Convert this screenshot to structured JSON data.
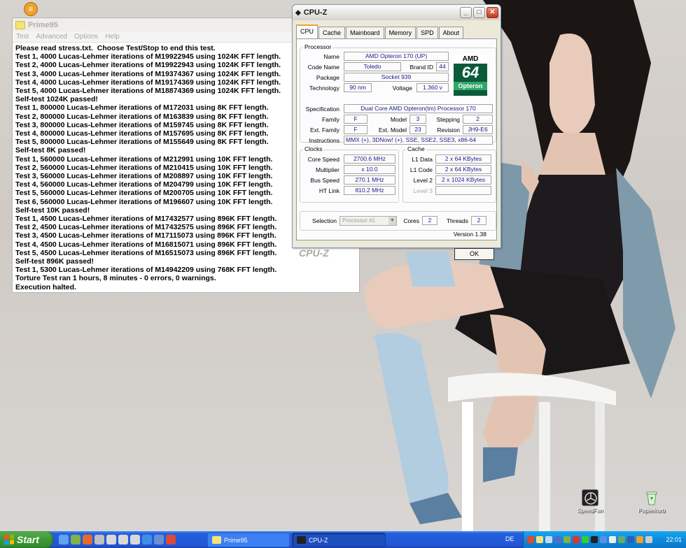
{
  "prime95": {
    "title": "Prime95",
    "menu": [
      "Test",
      "Advanced",
      "Options",
      "Help"
    ],
    "log": [
      "Please read stress.txt.  Choose Test/Stop to end this test.",
      "Test 1, 4000 Lucas-Lehmer iterations of M19922945 using 1024K FFT length.",
      "Test 2, 4000 Lucas-Lehmer iterations of M19922943 using 1024K FFT length.",
      "Test 3, 4000 Lucas-Lehmer iterations of M19374367 using 1024K FFT length.",
      "Test 4, 4000 Lucas-Lehmer iterations of M19174369 using 1024K FFT length.",
      "Test 5, 4000 Lucas-Lehmer iterations of M18874369 using 1024K FFT length.",
      "Self-test 1024K passed!",
      "Test 1, 800000 Lucas-Lehmer iterations of M172031 using 8K FFT length.",
      "Test 2, 800000 Lucas-Lehmer iterations of M163839 using 8K FFT length.",
      "Test 3, 800000 Lucas-Lehmer iterations of M159745 using 8K FFT length.",
      "Test 4, 800000 Lucas-Lehmer iterations of M157695 using 8K FFT length.",
      "Test 5, 800000 Lucas-Lehmer iterations of M155649 using 8K FFT length.",
      "Self-test 8K passed!",
      "Test 1, 560000 Lucas-Lehmer iterations of M212991 using 10K FFT length.",
      "Test 2, 560000 Lucas-Lehmer iterations of M210415 using 10K FFT length.",
      "Test 3, 560000 Lucas-Lehmer iterations of M208897 using 10K FFT length.",
      "Test 4, 560000 Lucas-Lehmer iterations of M204799 using 10K FFT length.",
      "Test 5, 560000 Lucas-Lehmer iterations of M200705 using 10K FFT length.",
      "Test 6, 560000 Lucas-Lehmer iterations of M196607 using 10K FFT length.",
      "Self-test 10K passed!",
      "Test 1, 4500 Lucas-Lehmer iterations of M17432577 using 896K FFT length.",
      "Test 2, 4500 Lucas-Lehmer iterations of M17432575 using 896K FFT length.",
      "Test 3, 4500 Lucas-Lehmer iterations of M17115073 using 896K FFT length.",
      "Test 4, 4500 Lucas-Lehmer iterations of M16815071 using 896K FFT length.",
      "Test 5, 4500 Lucas-Lehmer iterations of M16515073 using 896K FFT length.",
      "Self-test 896K passed!",
      "Test 1, 5300 Lucas-Lehmer iterations of M14942209 using 768K FFT length.",
      "Torture Test ran 1 hours, 8 minutes - 0 errors, 0 warnings.",
      "Execution halted."
    ]
  },
  "cpuz": {
    "title": "CPU-Z",
    "tabs": [
      "CPU",
      "Cache",
      "Mainboard",
      "Memory",
      "SPD",
      "About"
    ],
    "processor": {
      "group": "Processor",
      "name_label": "Name",
      "name": "AMD Opteron 170 (UP)",
      "codename_label": "Code Name",
      "codename": "Toledo",
      "brandid_label": "Brand ID",
      "brandid": "44",
      "package_label": "Package",
      "package": "Socket 939",
      "technology_label": "Technology",
      "technology": "90 nm",
      "voltage_label": "Voltage",
      "voltage": "1.360 v",
      "spec_label": "Specification",
      "spec": "Dual Core AMD Opteron(tm) Processor 170",
      "family_label": "Family",
      "family": "F",
      "model_label": "Model",
      "model": "3",
      "stepping_label": "Stepping",
      "stepping": "2",
      "extfamily_label": "Ext. Family",
      "extfamily": "F",
      "extmodel_label": "Ext. Model",
      "extmodel": "23",
      "revision_label": "Revision",
      "revision": "JH9-E6",
      "instructions_label": "Instructions",
      "instructions": "MMX (+), 3DNow! (+), SSE, SSE2, SSE3, x86-64",
      "logo_top": "AMD",
      "logo_mid": "64",
      "logo_bottom": "Opteron"
    },
    "clocks": {
      "group": "Clocks",
      "core_label": "Core Speed",
      "core": "2700.6 MHz",
      "mult_label": "Multiplier",
      "mult": "x 10.0",
      "bus_label": "Bus Speed",
      "bus": "270.1 MHz",
      "ht_label": "HT Link",
      "ht": "810.2 MHz"
    },
    "cache": {
      "group": "Cache",
      "l1d_label": "L1 Data",
      "l1d": "2 x 64 KBytes",
      "l1c_label": "L1 Code",
      "l1c": "2 x 64 KBytes",
      "l2_label": "Level 2",
      "l2": "2 x 1024 KBytes",
      "l3_label": "Level 3",
      "l3": ""
    },
    "selection_label": "Selection",
    "selection": "Processor #1",
    "cores_label": "Cores",
    "cores": "2",
    "threads_label": "Threads",
    "threads": "2",
    "version": "Version 1.38",
    "brand": "CPU-Z",
    "ok": "OK"
  },
  "desktop_icons": [
    "SpeedFan",
    "Papierkorb"
  ],
  "taskbar": {
    "start": "Start",
    "tasks": [
      "Prime95",
      "CPU-Z"
    ],
    "language": "DE",
    "clock": "22:01"
  }
}
